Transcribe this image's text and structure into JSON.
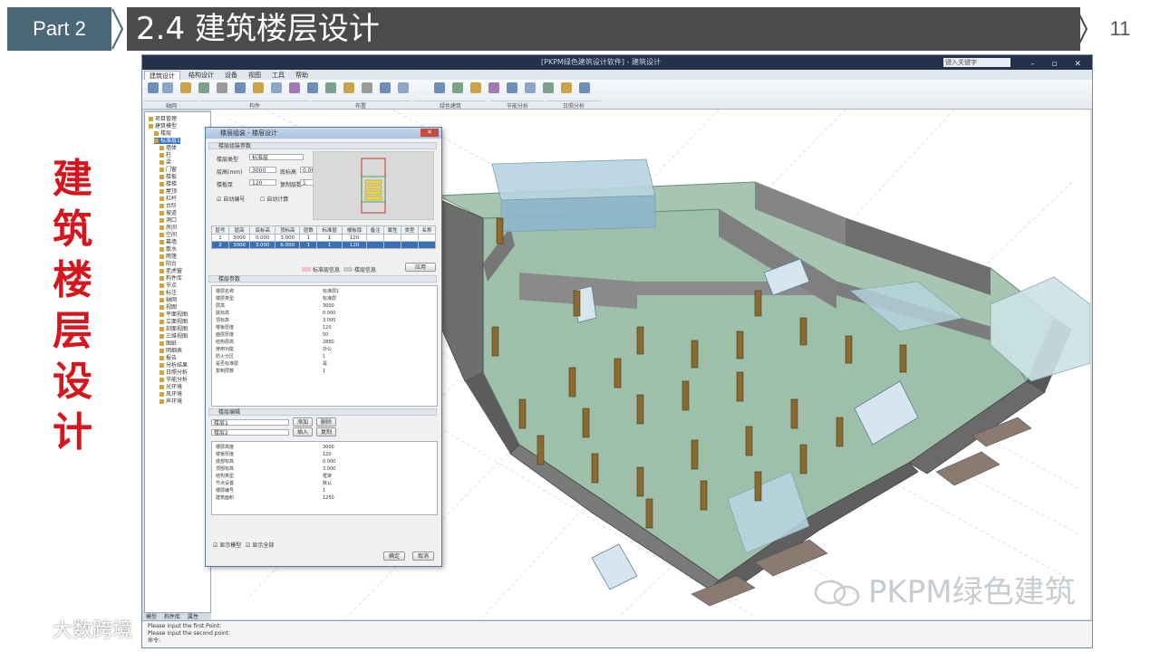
{
  "slide": {
    "part": "Part  2",
    "title": "2.4 建筑楼层设计",
    "page_number": "11",
    "side_title": [
      "建",
      "筑",
      "楼",
      "层",
      "设",
      "计"
    ]
  },
  "app": {
    "window_title": "[PKPM绿色建筑设计软件] - 建筑设计",
    "search_placeholder": "键入关键字",
    "tabs": [
      "建筑设计",
      "结构设计",
      "设备",
      "视图",
      "工具",
      "帮助"
    ],
    "ribbon_groups": [
      "轴网",
      "构件",
      "布置",
      "绿色建筑",
      "节能分析",
      "日照分析"
    ],
    "tree_items": [
      "项目管理",
      "建筑模型",
      "楼层",
      "标准层1",
      "墙体",
      "柱",
      "梁",
      "门窗",
      "楼板",
      "楼梯",
      "屋顶",
      "栏杆",
      "台阶",
      "坡道",
      "洞口",
      "房间",
      "空间",
      "幕墙",
      "散水",
      "雨篷",
      "阳台",
      "老虎窗",
      "构件库",
      "节点",
      "标注",
      "轴网",
      "视图",
      "平面视图",
      "立面视图",
      "剖面视图",
      "三维视图",
      "图纸",
      "明细表",
      "报告",
      "分析结果",
      "日照分析",
      "节能分析",
      "光环境",
      "风环境",
      "声环境"
    ],
    "tree_tabs": [
      "模型",
      "构件库",
      "属性"
    ],
    "command_lines": [
      "Please input the first Point:",
      "Please input the second point:",
      "命令:"
    ]
  },
  "dialog": {
    "title": "楼层组装 - 楼层设计",
    "section1": "楼层组装参数",
    "fields": {
      "type_label": "楼层类型",
      "type_value": "标准层",
      "height_label": "层高(mm)",
      "height_value": "3000",
      "elev_label": "底标高",
      "elev_value": "0.000",
      "thick_label": "楼板厚",
      "thick_value": "120",
      "count_label": "复制层数",
      "count_value": "1"
    },
    "checks": [
      "自动编号",
      "自动计算"
    ],
    "grid_headers": [
      "层号",
      "层高",
      "底标高",
      "顶标高",
      "层数",
      "标准层",
      "楼板厚",
      "备注",
      "属性",
      "类型",
      "名称"
    ],
    "grid_rows": [
      [
        "1",
        "3000",
        "0.000",
        "3.000",
        "1",
        "1",
        "120",
        "",
        "",
        "",
        ""
      ],
      [
        "2",
        "3000",
        "3.000",
        "6.000",
        "1",
        "1",
        "120",
        "",
        "",
        "",
        ""
      ]
    ],
    "legend": [
      "标准层信息",
      "楼层信息"
    ],
    "apply_button": "应用",
    "section2": "楼层参数",
    "props": [
      [
        "楼层名称",
        "标准层1"
      ],
      [
        "楼层类型",
        "标准层"
      ],
      [
        "层高",
        "3000"
      ],
      [
        "底标高",
        "0.000"
      ],
      [
        "顶标高",
        "3.000"
      ],
      [
        "楼板厚度",
        "120"
      ],
      [
        "面层厚度",
        "50"
      ],
      [
        "结构层高",
        "2880"
      ],
      [
        "使用功能",
        "办公"
      ],
      [
        "防火分区",
        "1"
      ],
      [
        "是否标准层",
        "是"
      ],
      [
        "复制层数",
        "1"
      ]
    ],
    "section3": "楼层编辑",
    "combo1": "楼层1",
    "combo2": "楼层2",
    "btn_a": "添加",
    "btn_b": "删除",
    "btn_c": "插入",
    "btn_d": "复制",
    "props2": [
      [
        "楼层高度",
        "3000"
      ],
      [
        "楼板厚度",
        "120"
      ],
      [
        "底部标高",
        "0.000"
      ],
      [
        "顶部标高",
        "3.000"
      ],
      [
        "结构类型",
        "框架"
      ],
      [
        "节点设置",
        "默认"
      ],
      [
        "楼层编号",
        "1"
      ],
      [
        "建筑面积",
        "1250"
      ]
    ],
    "footer_checks": [
      "显示模型",
      "显示全部"
    ],
    "ok_button": "确定",
    "cancel_button": "取消"
  },
  "watermark": "PKPM绿色建筑",
  "logo_text": "大数跨境",
  "colors": {
    "part_bg": "#4a6878",
    "title_bg": "#4b4b4b",
    "side_title": "#d8141c",
    "floor": "#9ebfa9",
    "wall": "#6e6e6e",
    "column": "#8a6a2e"
  }
}
